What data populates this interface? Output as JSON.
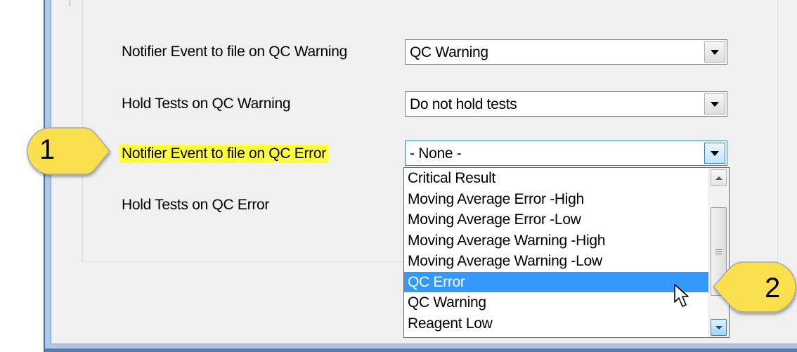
{
  "form": {
    "rows": [
      {
        "label": "Notifier Event to file on QC Warning",
        "value": "QC Warning"
      },
      {
        "label": "Hold Tests on QC Warning",
        "value": "Do not hold tests"
      },
      {
        "label": "Notifier Event to file on QC Error",
        "value": "- None -"
      },
      {
        "label": "Hold Tests on QC Error"
      }
    ]
  },
  "dropdown": {
    "items": [
      "Critical Result",
      "Moving Average Error -High",
      "Moving Average Error -Low",
      "Moving Average Warning -High",
      "Moving Average Warning -Low",
      "QC Error",
      "QC Warning",
      "Reagent Low"
    ],
    "selected_index": 5
  },
  "callouts": [
    {
      "label": "1"
    },
    {
      "label": "2"
    }
  ],
  "colors": {
    "highlight": "#ffff3c",
    "callout_fill": "#fbe04e",
    "selection": "#3399ff"
  },
  "icons": [
    "dropdown-arrow-icon",
    "scroll-up-icon",
    "scroll-down-icon",
    "scroll-grip-icon",
    "mouse-pointer-icon"
  ]
}
